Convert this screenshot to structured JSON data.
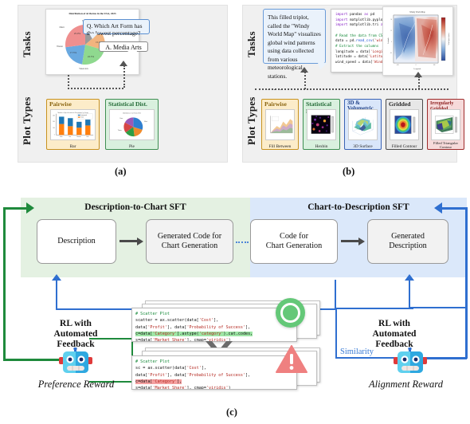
{
  "figure": {
    "panel_tags": [
      "(a)",
      "(b)",
      "(c)"
    ]
  },
  "panel_a": {
    "row_labels": [
      "Tasks",
      "Plot Types"
    ],
    "chart_title": "Distribution of Artforms in the USA, 2023",
    "question_bubble": "Q. Which Art Form has the lowest percentage?",
    "answer_bubble": "A. Media Arts",
    "plot_types": [
      {
        "title": "Pairwise",
        "caption": "Bar",
        "scheme": "orange"
      },
      {
        "title": "Statistical Dist.",
        "caption": "Pie",
        "scheme": "green"
      }
    ]
  },
  "panel_b": {
    "row_labels": [
      "Tasks",
      "Plot Types"
    ],
    "description_bubble": "This filled triplot, called the \"Windy World Map\" visualizes global wind patterns using data collected from various meteorological stations.",
    "ellipsis": ". . .",
    "code_lines": [
      "import pandas as pd",
      "import matplotlib.pyplot as plt",
      "import matplotlib.tri as tri",
      "",
      "# Read the data from CSV file",
      "data = pd.read_csv('wind_data.csv')",
      "# Extract the columns",
      "longitude = data['Longitude']",
      "latitude = data['Latitude']",
      "wind_speed = data['Wind Speed (m/s)']",
      "",
      ". . ."
    ],
    "chart_title": "Windy World Map",
    "chart_xlabel": "Longitude",
    "chart_ylabel": "Latitude",
    "chart_cbar_label": "Wind Speed (m/s)",
    "plot_types": [
      {
        "title": "Pairwise",
        "caption": "Fill Between",
        "scheme": "orange"
      },
      {
        "title": "Statistical Dist.",
        "caption": "Hexbin",
        "scheme": "green"
      },
      {
        "title": "3D & Volumetric",
        "caption": "3D Surface",
        "scheme": "blue"
      },
      {
        "title": "Gridded",
        "caption": "Filled Contour",
        "scheme": "gray"
      },
      {
        "title": "Irregularly Gridded",
        "caption": "Filled Triangular Contour",
        "scheme": "red"
      }
    ]
  },
  "panel_c": {
    "sft_left": {
      "title": "Description-to-Chart SFT",
      "nodes": [
        "Description",
        "Generated Code for\nChart Generation"
      ]
    },
    "sft_right": {
      "title": "Chart-to-Description SFT",
      "nodes": [
        "Code for\nChart Generation",
        "Generated\nDescription"
      ]
    },
    "rl_left": {
      "title": "RL with\nAutomated\nFeedback",
      "reward_caption": "Preference Reward"
    },
    "rl_right": {
      "title": "RL with\nAutomated\nFeedback",
      "reward_caption": "Alignment Reward",
      "similarity_label": "Similarity"
    },
    "snippet_good": {
      "lines": [
        "# Scatter Plot",
        "scatter = ax.scatter(data['Cost'],",
        "data['Profit'], data['Probability of Success'],",
        "c=data['Category'].astype('category').cat.codes,",
        "s=data['Market Share'], cmap='viridis')",
        ". . ."
      ],
      "highlight_line_index": 3,
      "badge": "check-circle"
    },
    "snippet_bad": {
      "lines": [
        "# Scatter Plot",
        "sc = ax.scatter(data['Cost'],",
        "data['Profit'], data['Probability of Success'],",
        "c=data['Category'],",
        "s=data['Market Share'], cmap='viridis')",
        ". . ."
      ],
      "highlight_line_index": 3,
      "badge": "warning-triangle"
    },
    "colors": {
      "sft_left_bg": "#e4f1e2",
      "sft_right_bg": "#dbe8fa",
      "green_arrow": "#1f8a3c",
      "blue_arrow": "#2f6fd0",
      "ok_badge": "#64c878",
      "warn_badge": "#ef8080"
    }
  }
}
